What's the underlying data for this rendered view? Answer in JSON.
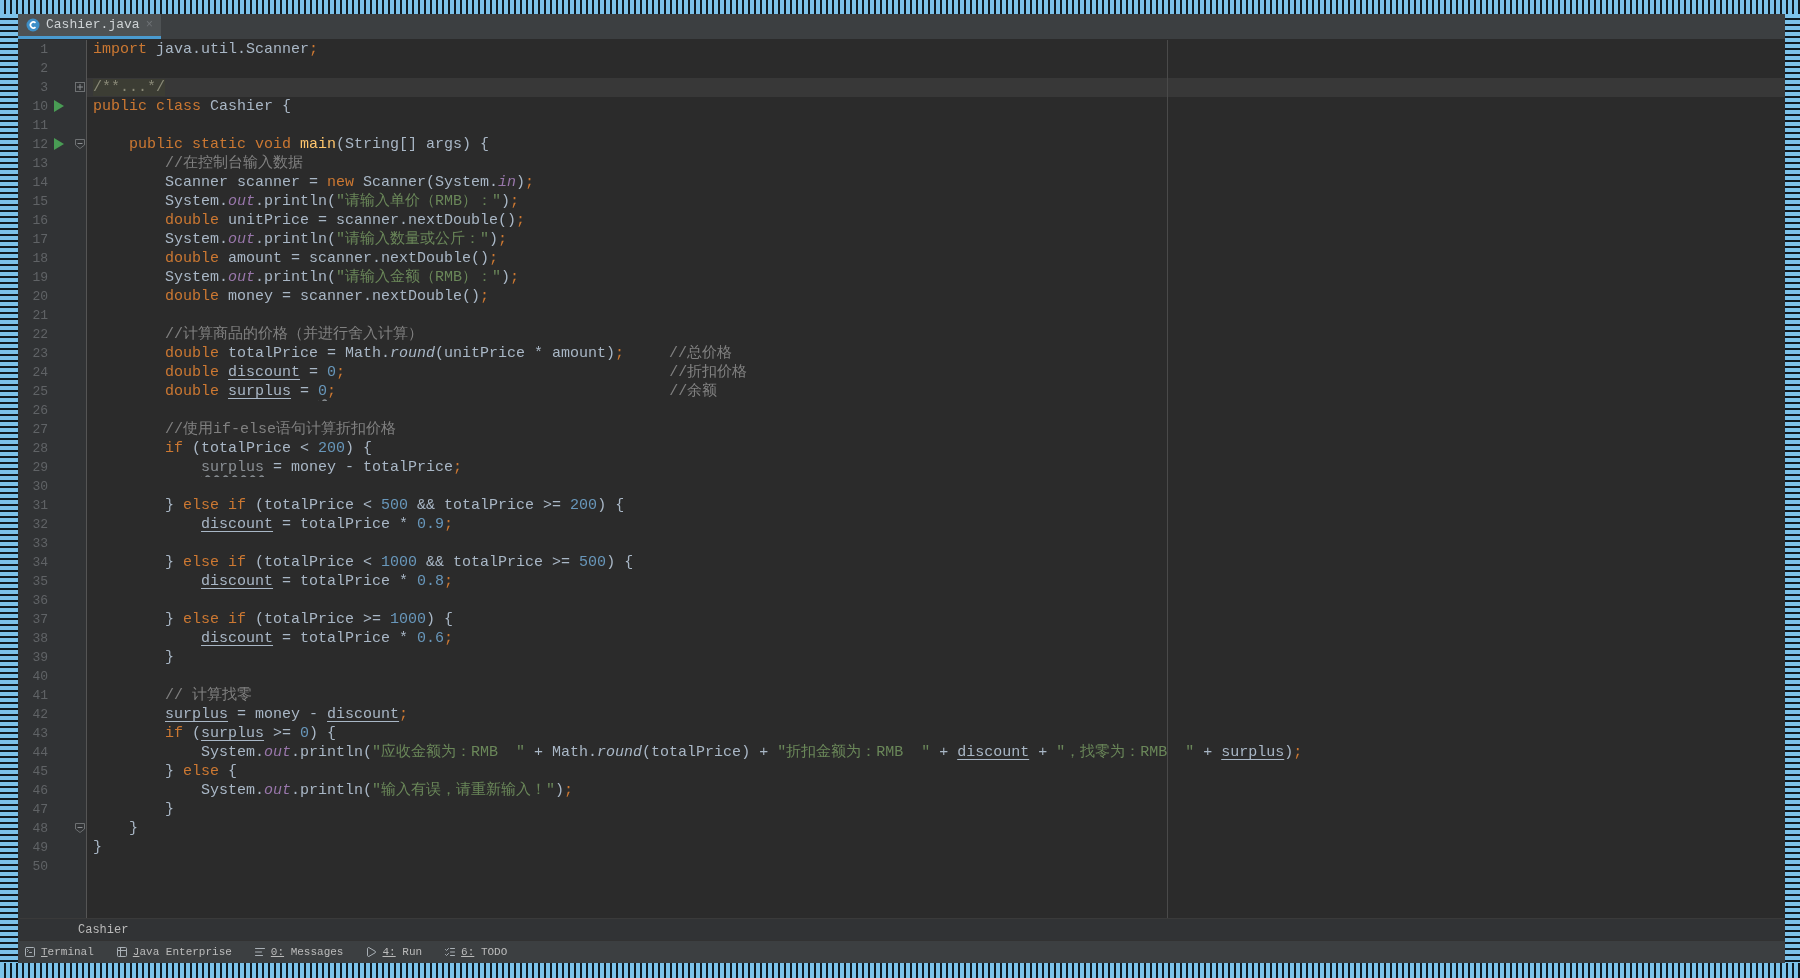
{
  "tabs": [
    {
      "label": "Cashier.java",
      "close": "×",
      "selected": true
    }
  ],
  "lines": [
    {
      "number": "1",
      "current": false,
      "tokens": [
        {
          "kind": "keyword",
          "text": "import "
        },
        {
          "kind": "plain",
          "text": "java.util.Scanner"
        },
        {
          "kind": "keyword",
          "text": ";"
        }
      ]
    },
    {
      "number": "2",
      "current": false
    },
    {
      "number": "3",
      "current": true,
      "gutter_icons": [
        {
          "kind": "fold",
          "expanded": false
        }
      ],
      "tokens": [
        {
          "kind": "folded",
          "text": "/**...*/"
        }
      ]
    },
    {
      "number": "10",
      "current": false,
      "gutter_icons": [
        {
          "kind": "run"
        }
      ],
      "tokens": [
        {
          "kind": "keyword",
          "text": "public class "
        },
        {
          "kind": "plain",
          "text": "Cashier {"
        }
      ]
    },
    {
      "number": "11",
      "current": false
    },
    {
      "number": "12",
      "current": false,
      "gutter_icons": [
        {
          "kind": "run"
        },
        {
          "kind": "fold",
          "expanded": true
        }
      ],
      "tokens": [
        {
          "kind": "keyword",
          "text": "    public static void "
        },
        {
          "kind": "method",
          "text": "main"
        },
        {
          "kind": "plain",
          "text": "(String[] args) {"
        }
      ]
    },
    {
      "number": "13",
      "current": false,
      "tokens": [
        {
          "kind": "comment",
          "text": "        //在控制台输入数据"
        }
      ]
    },
    {
      "number": "14",
      "current": false,
      "tokens": [
        {
          "kind": "plain",
          "text": "        Scanner scanner = "
        },
        {
          "kind": "keyword",
          "text": "new "
        },
        {
          "kind": "plain",
          "text": "Scanner(System."
        },
        {
          "kind": "field",
          "text": "in"
        },
        {
          "kind": "plain",
          "text": ")"
        },
        {
          "kind": "keyword",
          "text": ";"
        }
      ]
    },
    {
      "number": "15",
      "current": false,
      "tokens": [
        {
          "kind": "plain",
          "text": "        System."
        },
        {
          "kind": "field",
          "text": "out"
        },
        {
          "kind": "plain",
          "text": ".println("
        },
        {
          "kind": "string",
          "text": "\"请输入单价（RMB）：\""
        },
        {
          "kind": "plain",
          "text": ")"
        },
        {
          "kind": "keyword",
          "text": ";"
        }
      ]
    },
    {
      "number": "16",
      "current": false,
      "tokens": [
        {
          "kind": "keyword",
          "text": "        double "
        },
        {
          "kind": "plain",
          "text": "unitPrice = scanner.nextDouble()"
        },
        {
          "kind": "keyword",
          "text": ";"
        }
      ]
    },
    {
      "number": "17",
      "current": false,
      "tokens": [
        {
          "kind": "plain",
          "text": "        System."
        },
        {
          "kind": "field",
          "text": "out"
        },
        {
          "kind": "plain",
          "text": ".println("
        },
        {
          "kind": "string",
          "text": "\"请输入数量或公斤：\""
        },
        {
          "kind": "plain",
          "text": ")"
        },
        {
          "kind": "keyword",
          "text": ";"
        }
      ]
    },
    {
      "number": "18",
      "current": false,
      "tokens": [
        {
          "kind": "keyword",
          "text": "        double "
        },
        {
          "kind": "plain",
          "text": "amount = scanner.nextDouble()"
        },
        {
          "kind": "keyword",
          "text": ";"
        }
      ]
    },
    {
      "number": "19",
      "current": false,
      "tokens": [
        {
          "kind": "plain",
          "text": "        System."
        },
        {
          "kind": "field",
          "text": "out"
        },
        {
          "kind": "plain",
          "text": ".println("
        },
        {
          "kind": "string",
          "text": "\"请输入金额（RMB）：\""
        },
        {
          "kind": "plain",
          "text": ")"
        },
        {
          "kind": "keyword",
          "text": ";"
        }
      ]
    },
    {
      "number": "20",
      "current": false,
      "tokens": [
        {
          "kind": "keyword",
          "text": "        double "
        },
        {
          "kind": "plain",
          "text": "money = scanner.nextDouble()"
        },
        {
          "kind": "keyword",
          "text": ";"
        }
      ]
    },
    {
      "number": "21",
      "current": false
    },
    {
      "number": "22",
      "current": false,
      "tokens": [
        {
          "kind": "comment",
          "text": "        //计算商品的价格（并进行舍入计算）"
        }
      ]
    },
    {
      "number": "23",
      "current": false,
      "tokens": [
        {
          "kind": "keyword",
          "text": "        double "
        },
        {
          "kind": "plain",
          "text": "totalPrice = Math."
        },
        {
          "kind": "static",
          "text": "round"
        },
        {
          "kind": "plain",
          "text": "(unitPrice * amount)"
        },
        {
          "kind": "keyword",
          "text": ";"
        },
        {
          "kind": "comment",
          "text": "     //总价格"
        }
      ]
    },
    {
      "number": "24",
      "current": false,
      "tokens": [
        {
          "kind": "keyword",
          "text": "        double "
        },
        {
          "kind": "reassigned",
          "text": "discount"
        },
        {
          "kind": "plain",
          "text": " = "
        },
        {
          "kind": "number",
          "text": "0"
        },
        {
          "kind": "keyword",
          "text": ";"
        },
        {
          "kind": "comment",
          "text": "                                    //折扣价格"
        }
      ]
    },
    {
      "number": "25",
      "current": false,
      "tokens": [
        {
          "kind": "keyword",
          "text": "        double "
        },
        {
          "kind": "reassigned",
          "text": "surplus"
        },
        {
          "kind": "plain",
          "text": " = "
        },
        {
          "kind": "redundant",
          "text": "0"
        },
        {
          "kind": "keyword",
          "text": ";"
        },
        {
          "kind": "comment",
          "text": "                                     //余额"
        }
      ]
    },
    {
      "number": "26",
      "current": false
    },
    {
      "number": "27",
      "current": false,
      "tokens": [
        {
          "kind": "comment",
          "text": "        //使用if-else语句计算折扣价格"
        }
      ]
    },
    {
      "number": "28",
      "current": false,
      "tokens": [
        {
          "kind": "keyword",
          "text": "        if "
        },
        {
          "kind": "plain",
          "text": "(totalPrice < "
        },
        {
          "kind": "number",
          "text": "200"
        },
        {
          "kind": "plain",
          "text": ") {"
        }
      ]
    },
    {
      "number": "29",
      "current": false,
      "tokens": [
        {
          "kind": "unused",
          "text": "            surplus"
        },
        {
          "kind": "plain",
          "text": " = money - totalPrice"
        },
        {
          "kind": "keyword",
          "text": ";"
        }
      ]
    },
    {
      "number": "30",
      "current": false
    },
    {
      "number": "31",
      "current": false,
      "tokens": [
        {
          "kind": "plain",
          "text": "        } "
        },
        {
          "kind": "keyword",
          "text": "else if "
        },
        {
          "kind": "plain",
          "text": "(totalPrice < "
        },
        {
          "kind": "number",
          "text": "500"
        },
        {
          "kind": "plain",
          "text": " && totalPrice >= "
        },
        {
          "kind": "number",
          "text": "200"
        },
        {
          "kind": "plain",
          "text": ") {"
        }
      ]
    },
    {
      "number": "32",
      "current": false,
      "tokens": [
        {
          "kind": "reassigned",
          "text": "            discount"
        },
        {
          "kind": "plain",
          "text": " = totalPrice * "
        },
        {
          "kind": "number",
          "text": "0.9"
        },
        {
          "kind": "keyword",
          "text": ";"
        }
      ]
    },
    {
      "number": "33",
      "current": false
    },
    {
      "number": "34",
      "current": false,
      "tokens": [
        {
          "kind": "plain",
          "text": "        } "
        },
        {
          "kind": "keyword",
          "text": "else if "
        },
        {
          "kind": "plain",
          "text": "(totalPrice < "
        },
        {
          "kind": "number",
          "text": "1000"
        },
        {
          "kind": "plain",
          "text": " && totalPrice >= "
        },
        {
          "kind": "number",
          "text": "500"
        },
        {
          "kind": "plain",
          "text": ") {"
        }
      ]
    },
    {
      "number": "35",
      "current": false,
      "tokens": [
        {
          "kind": "reassigned",
          "text": "            discount"
        },
        {
          "kind": "plain",
          "text": " = totalPrice * "
        },
        {
          "kind": "number",
          "text": "0.8"
        },
        {
          "kind": "keyword",
          "text": ";"
        }
      ]
    },
    {
      "number": "36",
      "current": false
    },
    {
      "number": "37",
      "current": false,
      "tokens": [
        {
          "kind": "plain",
          "text": "        } "
        },
        {
          "kind": "keyword",
          "text": "else if "
        },
        {
          "kind": "plain",
          "text": "(totalPrice >= "
        },
        {
          "kind": "number",
          "text": "1000"
        },
        {
          "kind": "plain",
          "text": ") {"
        }
      ]
    },
    {
      "number": "38",
      "current": false,
      "tokens": [
        {
          "kind": "reassigned",
          "text": "            discount"
        },
        {
          "kind": "plain",
          "text": " = totalPrice * "
        },
        {
          "kind": "number",
          "text": "0.6"
        },
        {
          "kind": "keyword",
          "text": ";"
        }
      ]
    },
    {
      "number": "39",
      "current": false,
      "tokens": [
        {
          "kind": "plain",
          "text": "        }"
        }
      ]
    },
    {
      "number": "40",
      "current": false
    },
    {
      "number": "41",
      "current": false,
      "tokens": [
        {
          "kind": "comment",
          "text": "        // 计算找零"
        }
      ]
    },
    {
      "number": "42",
      "current": false,
      "tokens": [
        {
          "kind": "reassigned",
          "text": "        surplus"
        },
        {
          "kind": "plain",
          "text": " = money - "
        },
        {
          "kind": "reassigned",
          "text": "discount"
        },
        {
          "kind": "keyword",
          "text": ";"
        }
      ]
    },
    {
      "number": "43",
      "current": false,
      "tokens": [
        {
          "kind": "keyword",
          "text": "        if "
        },
        {
          "kind": "plain",
          "text": "("
        },
        {
          "kind": "reassigned",
          "text": "surplus"
        },
        {
          "kind": "plain",
          "text": " >= "
        },
        {
          "kind": "number",
          "text": "0"
        },
        {
          "kind": "plain",
          "text": ") {"
        }
      ]
    },
    {
      "number": "44",
      "current": false,
      "tokens": [
        {
          "kind": "plain",
          "text": "            System."
        },
        {
          "kind": "field",
          "text": "out"
        },
        {
          "kind": "plain",
          "text": ".println("
        },
        {
          "kind": "string",
          "text": "\"应收金额为：RMB  \""
        },
        {
          "kind": "plain",
          "text": " + Math."
        },
        {
          "kind": "static",
          "text": "round"
        },
        {
          "kind": "plain",
          "text": "(totalPrice) + "
        },
        {
          "kind": "string",
          "text": "\"折扣金额为：RMB  \""
        },
        {
          "kind": "plain",
          "text": " + "
        },
        {
          "kind": "reassigned",
          "text": "discount"
        },
        {
          "kind": "plain",
          "text": " + "
        },
        {
          "kind": "string",
          "text": "\"，找零为：RMB  \""
        },
        {
          "kind": "plain",
          "text": " + "
        },
        {
          "kind": "reassigned",
          "text": "surplus"
        },
        {
          "kind": "plain",
          "text": ")"
        },
        {
          "kind": "keyword",
          "text": ";"
        }
      ]
    },
    {
      "number": "45",
      "current": false,
      "tokens": [
        {
          "kind": "plain",
          "text": "        } "
        },
        {
          "kind": "keyword",
          "text": "else "
        },
        {
          "kind": "plain",
          "text": "{"
        }
      ]
    },
    {
      "number": "46",
      "current": false,
      "tokens": [
        {
          "kind": "plain",
          "text": "            System."
        },
        {
          "kind": "field",
          "text": "out"
        },
        {
          "kind": "plain",
          "text": ".println("
        },
        {
          "kind": "string",
          "text": "\"输入有误，请重新输入！\""
        },
        {
          "kind": "plain",
          "text": ")"
        },
        {
          "kind": "keyword",
          "text": ";"
        }
      ]
    },
    {
      "number": "47",
      "current": false,
      "tokens": [
        {
          "kind": "plain",
          "text": "        }"
        }
      ]
    },
    {
      "number": "48",
      "current": false,
      "gutter_icons": [
        {
          "kind": "fold",
          "expanded": true
        }
      ],
      "tokens": [
        {
          "kind": "plain",
          "text": "    }"
        }
      ]
    },
    {
      "number": "49",
      "current": false,
      "tokens": [
        {
          "kind": "plain",
          "text": "}"
        }
      ]
    },
    {
      "number": "50",
      "current": false
    }
  ],
  "breadcrumb": "Cashier",
  "tool_windows": [
    {
      "kind": "terminal",
      "label": "Terminal"
    },
    {
      "kind": "enterprise",
      "label": "Java Enterprise"
    },
    {
      "kind": "messages",
      "label": "0: Messages"
    },
    {
      "kind": "run",
      "label": "4: Run"
    },
    {
      "kind": "todo",
      "label": "6: TODO"
    }
  ]
}
